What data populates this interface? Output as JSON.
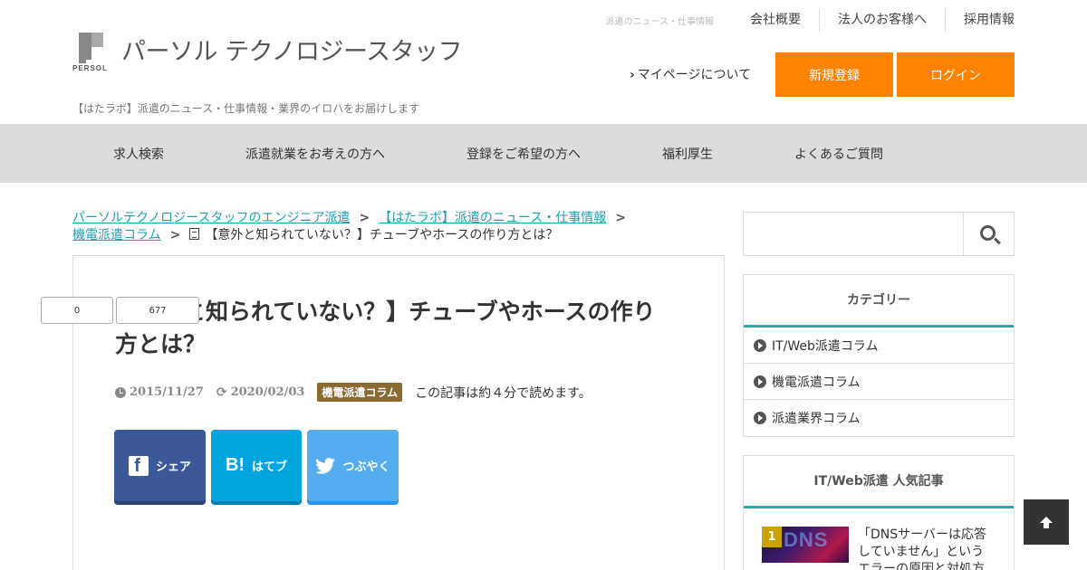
{
  "header": {
    "logo_wordmark": "PERSOL",
    "logo_text": "パーソル テクノロジースタッフ",
    "tagline": "【はたラボ】派遣のニュース・仕事情報・業界のイロハをお届けします",
    "top_small": "派遣のニュース・仕事情報",
    "top_links": [
      "会社概要",
      "法人のお客様へ",
      "採用情報"
    ],
    "mypage_label": "マイページについて",
    "register_label": "新規登録",
    "login_label": "ログイン",
    "accent_color": "#ff8200"
  },
  "nav": {
    "items": [
      "求人検索",
      "派遣就業をお考えの方へ",
      "登録をご希望の方へ",
      "福利厚生",
      "よくあるご質問"
    ]
  },
  "breadcrumb": {
    "items": [
      "パーソルテクノロジースタッフのエンジニア派遣",
      "【はたラボ】派遣のニュース・仕事情報",
      "機電派遣コラム"
    ],
    "current": "【意外と知られていない？】チューブやホースの作り方とは？"
  },
  "article": {
    "title": "【意外と知られていない？】チューブやホースの作り方とは？",
    "published": "2015/11/27",
    "updated": "2020/02/03",
    "category": "機電派遣コラム",
    "read_time": "この記事は約４分で読めます。",
    "share": {
      "facebook": "シェア",
      "hatena": "はてブ",
      "twitter": "つぶやく"
    },
    "counts": [
      "0",
      "677"
    ]
  },
  "sidebar": {
    "search_placeholder": "",
    "categories_title": "カテゴリー",
    "categories": [
      "IT/Web派遣コラム",
      "機電派遣コラム",
      "派遣業界コラム"
    ],
    "popular_title": "IT/Web派遣 人気記事",
    "popular": [
      {
        "rank": "1",
        "thumb_text": "DNS",
        "title": "「DNSサーバーは応答していません」というエラーの原因と対処方"
      }
    ],
    "accent_color": "#20b2aa"
  },
  "icons": {
    "to_top": "arrow-up-icon",
    "search": "search-icon"
  }
}
